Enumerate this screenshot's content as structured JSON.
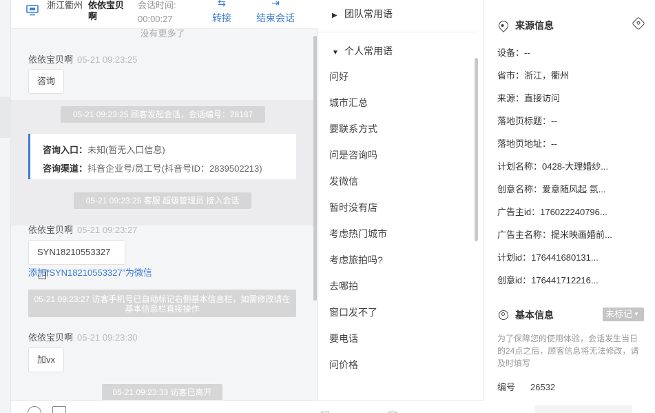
{
  "header": {
    "location": "浙江衢州",
    "visitor_name": "依依宝贝啊",
    "session_time_label": "会话时间:",
    "session_time": "00:00:27",
    "transfer_label": "转接",
    "end_label": "结束会话"
  },
  "chat": {
    "no_more": "没有更多了",
    "messages": [
      {
        "sender": "依依宝贝啊",
        "time": "05-21 09:23:25",
        "text": "咨询"
      },
      {
        "system": "05-21 09:23:25 顾客发起会话，会话编号：28187"
      },
      {
        "system": "05-21 09:23:25 客服 超级管理员 接入会话"
      },
      {
        "sender": "依依宝贝啊",
        "time": "05-21 09:23:27",
        "text": "SYN18210553327"
      },
      {
        "system": "05-21 09:23:27 访客手机号已自动标记右侧基本信息栏，如需修改请在基本信息栏直接操作"
      },
      {
        "sender": "依依宝贝啊",
        "time": "05-21 09:23:30",
        "text": "加vx"
      },
      {
        "system": "05-21 09:23:33 访客已离开"
      }
    ],
    "info_card": {
      "entry_label": "咨询入口：",
      "entry_value": "未知(暂无入口信息)",
      "channel_label": "咨询渠道：",
      "channel_value": "抖音企业号/员工号(抖音号ID：2839502213)"
    },
    "add_wechat": "添加“SYN18210553327”为微信"
  },
  "phrases": {
    "team_group": "团队常用语",
    "personal_group": "个人常用语",
    "items": [
      "问好",
      "城市汇总",
      "要联系方式",
      "问是咨询吗",
      "发微信",
      "暂时没有店",
      "考虑热门城市",
      "考虑旅拍吗?",
      "去哪拍",
      "窗口发不了",
      "要电话",
      "问价格"
    ]
  },
  "source_info": {
    "title": "来源信息",
    "fields": [
      "设备：--",
      "省市：浙江，衢州",
      "来源：直接访问",
      "落地页标题：--",
      "落地页地址：--",
      "计划名称：0428-大理婚纱...",
      "创意名称：爱意随风起 氛...",
      "广告主id：176022240796...",
      "广告主名称：提米映画婚前...",
      "计划id：176441680131...",
      "创意id：176441712216..."
    ]
  },
  "basic_info": {
    "title": "基本信息",
    "tag_select": "未标记",
    "note": "为了保障您的使用体验，会话发生当日的24点之后，顾客信息将无法修改，请及时填写",
    "id_label": "编号",
    "id_value": "26532"
  },
  "colors": {
    "accent": "#3a7bd5",
    "system_pill": "#d6d6d6"
  }
}
